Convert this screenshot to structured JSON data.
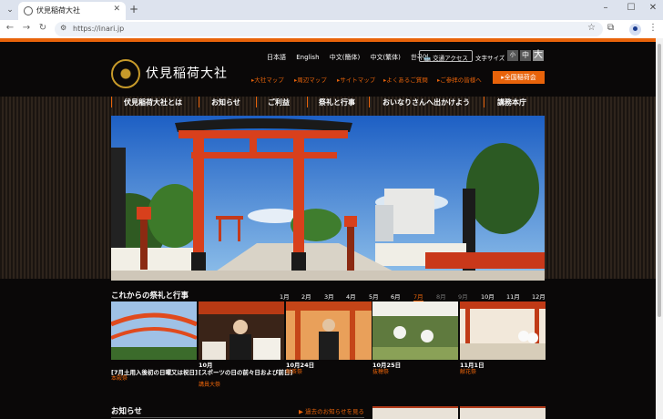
{
  "browser": {
    "tab_title": "伏見稲荷大社",
    "tab_list_icon": "⌄",
    "close_icon": "✕",
    "new_tab_icon": "+",
    "url": "https://inari.jp",
    "window_controls": [
      "–",
      "☐",
      "✕"
    ]
  },
  "site": {
    "languages": [
      "日本語",
      "English",
      "中文(簡体)",
      "中文(繁体)",
      "한국어"
    ],
    "access_label": "交通アクセス",
    "font_size_label": "文字サイズ",
    "font_sizes": [
      "小",
      "中",
      "大"
    ],
    "logo_text": "伏見稲荷大社",
    "quick_links": [
      "大社マップ",
      "周辺マップ",
      "サイトマップ",
      "よくあるご質問",
      "ご参拝の皆様へ"
    ],
    "zenkoku_label": "全国稲荷会",
    "nav": [
      "伏見稲荷大社とは",
      "お知らせ",
      "ご利益",
      "祭礼と行事",
      "おいなりさんへ出かけよう",
      "講務本庁"
    ]
  },
  "schedule": {
    "title": "これからの祭礼と行事",
    "months": [
      "1月",
      "2月",
      "3月",
      "4月",
      "5月",
      "6月",
      "7月",
      "8月",
      "9月",
      "10月",
      "11月",
      "12月"
    ],
    "active_month": "7月",
    "events": [
      {
        "date": "[7月土用入後初の日曜又は祝日]",
        "sub": "本殿祭"
      },
      {
        "date": "10月",
        "date2": "[スポーツの日の前々日および前日]",
        "sub": "講員大祭"
      },
      {
        "date": "10月24日",
        "sub": "献茶祭"
      },
      {
        "date": "10月25日",
        "sub": "抜穂祭"
      },
      {
        "date": "11月1日",
        "sub": "献花祭"
      }
    ]
  },
  "news": {
    "title": "お知らせ",
    "past_link": "過去のお知らせを見る"
  },
  "colors": {
    "accent": "#e8630a",
    "torii": "#d8401c",
    "background": "#0a0808"
  }
}
